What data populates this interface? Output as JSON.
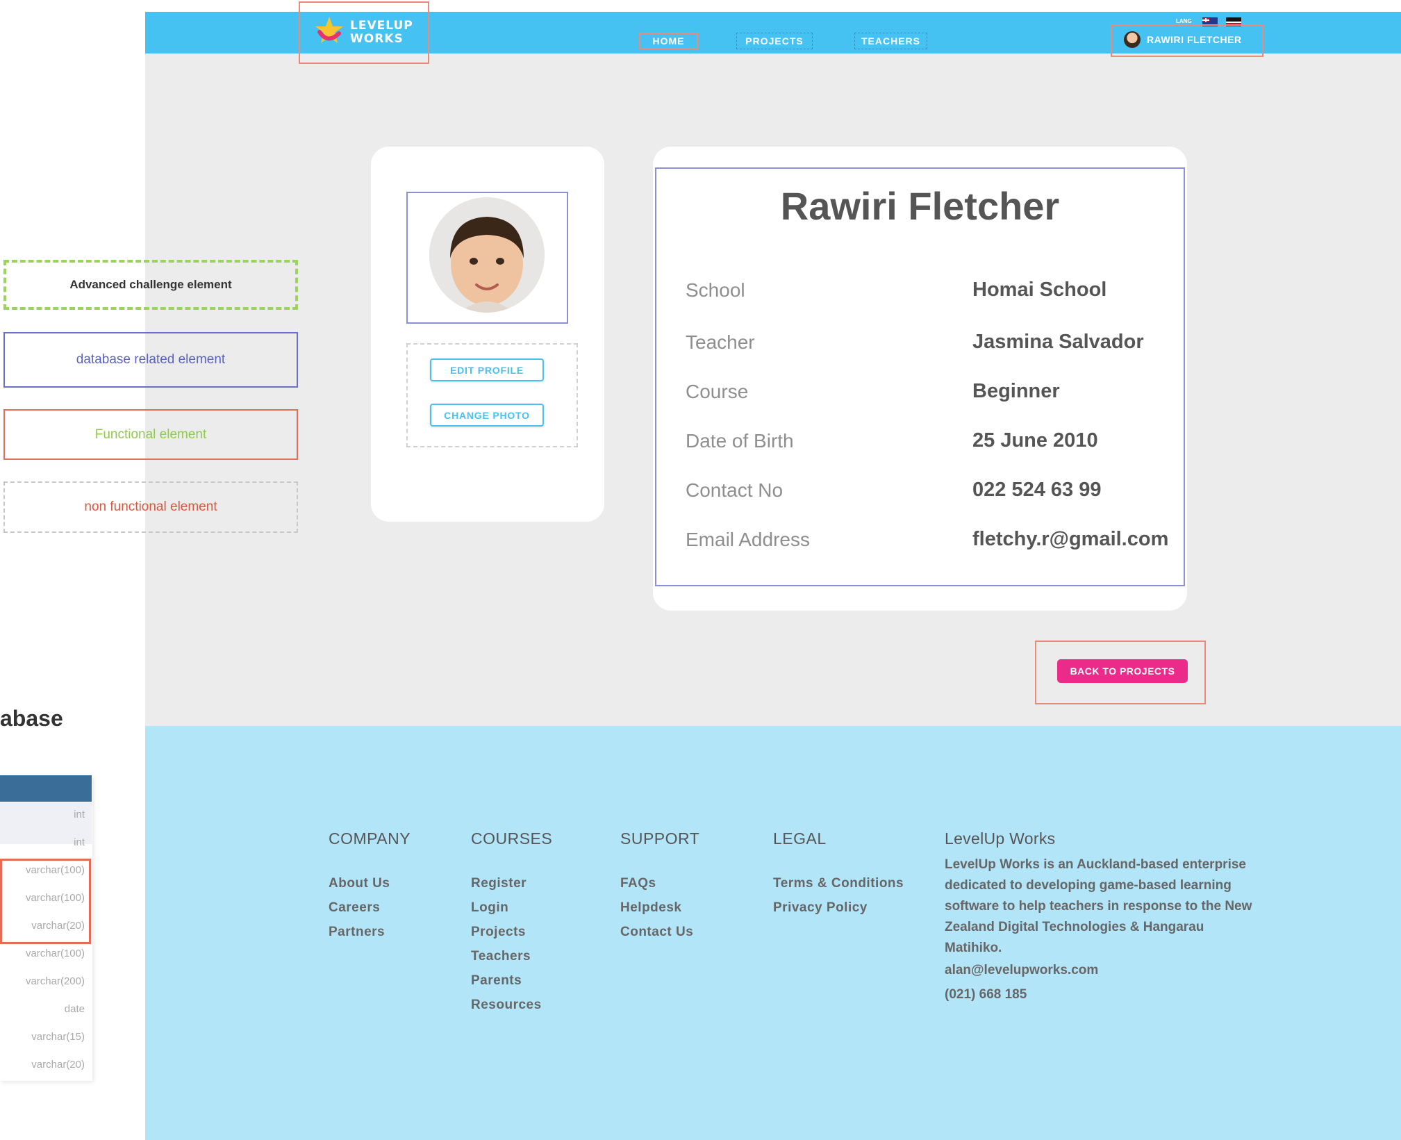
{
  "nav": {
    "logo_line1": "LEVELUP",
    "logo_line2": "WORKS",
    "items": [
      {
        "label": "HOME"
      },
      {
        "label": "PROJECTS"
      },
      {
        "label": "TEACHERS"
      }
    ],
    "lang_label": "LANG",
    "user_name": "RAWIRI FLETCHER"
  },
  "profile": {
    "edit_label": "EDIT PROFILE",
    "change_photo_label": "CHANGE PHOTO",
    "name": "Rawiri Fletcher",
    "fields": [
      {
        "label": "School",
        "value": "Homai School"
      },
      {
        "label": "Teacher",
        "value": "Jasmina Salvador"
      },
      {
        "label": "Course",
        "value": "Beginner"
      },
      {
        "label": "Date of Birth",
        "value": "25 June 2010"
      },
      {
        "label": "Contact No",
        "value": "022 524 63 99"
      },
      {
        "label": "Email Address",
        "value": "fletchy.r@gmail.com"
      }
    ],
    "back_label": "BACK TO PROJECTS"
  },
  "legend": {
    "advanced": "Advanced challenge element",
    "database": "database related element",
    "functional": "Functional element",
    "non_functional": "non functional element"
  },
  "database": {
    "title": "abase",
    "types": [
      "int",
      "int",
      "varchar(100)",
      "varchar(100)",
      "varchar(20)",
      "varchar(100)",
      "varchar(200)",
      "date",
      "varchar(15)",
      "varchar(20)"
    ]
  },
  "footer": {
    "company": {
      "heading": "COMPANY",
      "links": [
        "About Us",
        "Careers",
        "Partners"
      ]
    },
    "courses": {
      "heading": "COURSES",
      "links": [
        "Register",
        "Login",
        "Projects",
        "Teachers",
        "Parents",
        "Resources"
      ]
    },
    "support": {
      "heading": "SUPPORT",
      "links": [
        "FAQs",
        "Helpdesk",
        "Contact Us"
      ]
    },
    "legal": {
      "heading": "LEGAL",
      "links": [
        "Terms & Conditions",
        "Privacy Policy"
      ]
    },
    "about": {
      "heading": "LevelUp Works",
      "text": "LevelUp Works is an Auckland-based enterprise dedicated to developing game-based learning software to help teachers in response to the New Zealand Digital Technologies & Hangarau Matihiko.",
      "email": "alan@levelupworks.com",
      "phone": "(021) 668 185"
    }
  }
}
